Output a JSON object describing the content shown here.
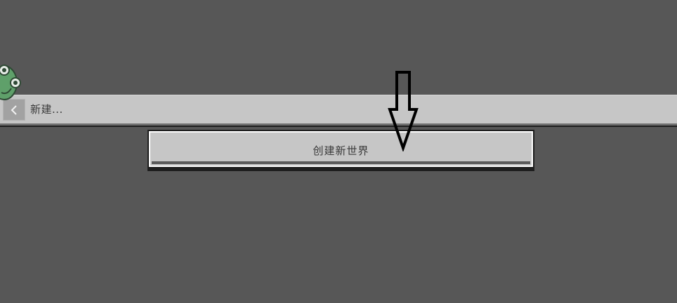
{
  "header": {
    "back_icon": "chevron-left-icon",
    "title": "新建..."
  },
  "main": {
    "create_world_label": "创建新世界"
  },
  "decorations": {
    "mascot_icon": "frog-icon",
    "annotation_icon": "down-arrow-icon"
  },
  "colors": {
    "background": "#575757",
    "panel": "#c6c6c6",
    "text": "#3a3a3a",
    "frog_green": "#5fa06a"
  }
}
